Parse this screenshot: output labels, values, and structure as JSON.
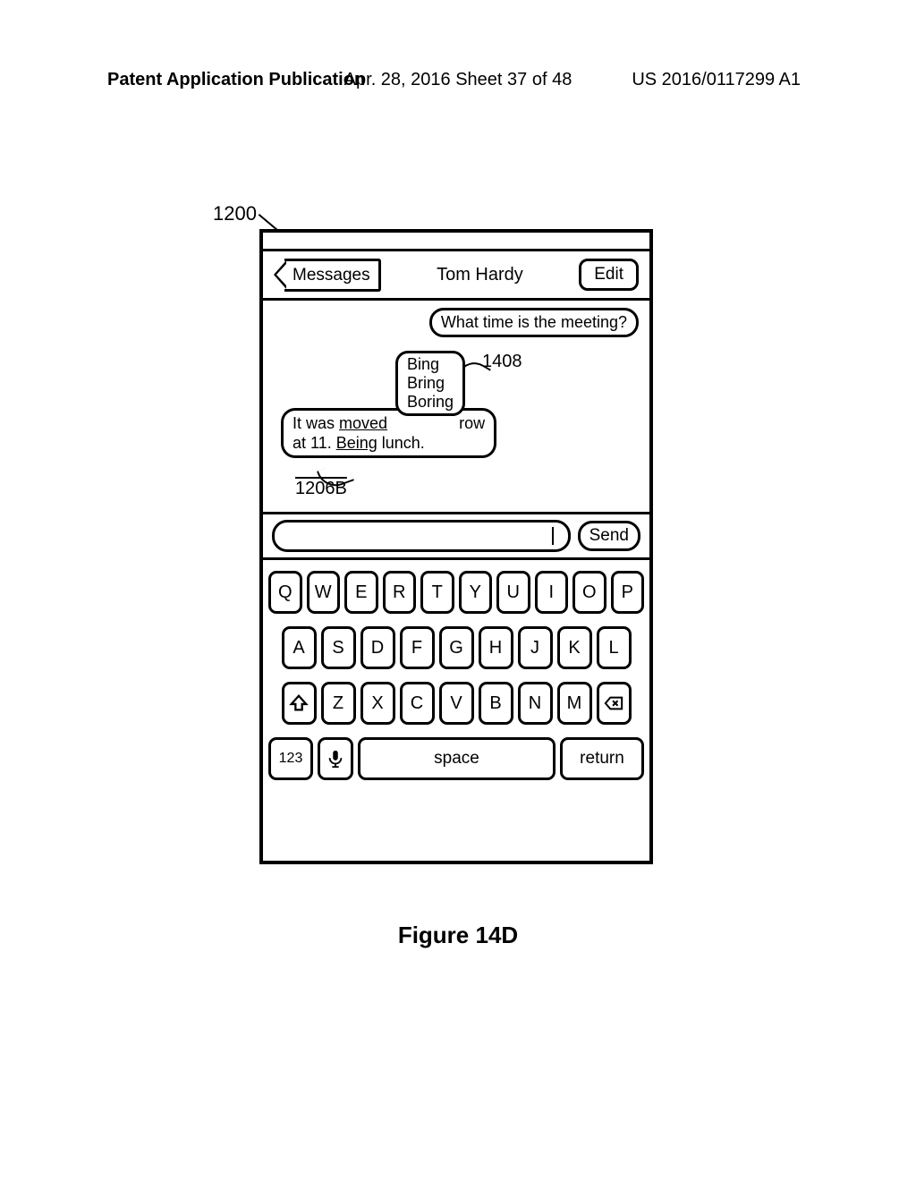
{
  "page_header": {
    "left": "Patent Application Publication",
    "center": "Apr. 28, 2016  Sheet 37 of 48",
    "right": "US 2016/0117299 A1"
  },
  "figure_caption": "Figure 14D",
  "refs": {
    "device": "1200",
    "suggestions": "1408",
    "bubble": "1206B"
  },
  "nav": {
    "back": "Messages",
    "title": "Tom Hardy",
    "edit": "Edit"
  },
  "conversation": {
    "outgoing": "What time is the meeting?",
    "incoming_pre": "It was ",
    "incoming_u1": "moved",
    "incoming_between": " ",
    "incoming_row": "row",
    "incoming_line2_pre": "at 11. ",
    "incoming_u2": "Being",
    "incoming_line2_post": " lunch."
  },
  "suggestions": [
    "Bing",
    "Bring",
    "Boring"
  ],
  "compose": {
    "send": "Send"
  },
  "keyboard": {
    "row1": [
      "Q",
      "W",
      "E",
      "R",
      "T",
      "Y",
      "U",
      "I",
      "O",
      "P"
    ],
    "row2": [
      "A",
      "S",
      "D",
      "F",
      "G",
      "H",
      "J",
      "K",
      "L"
    ],
    "row3": [
      "Z",
      "X",
      "C",
      "V",
      "B",
      "N",
      "M"
    ],
    "k123": "123",
    "space": "space",
    "ret": "return"
  }
}
